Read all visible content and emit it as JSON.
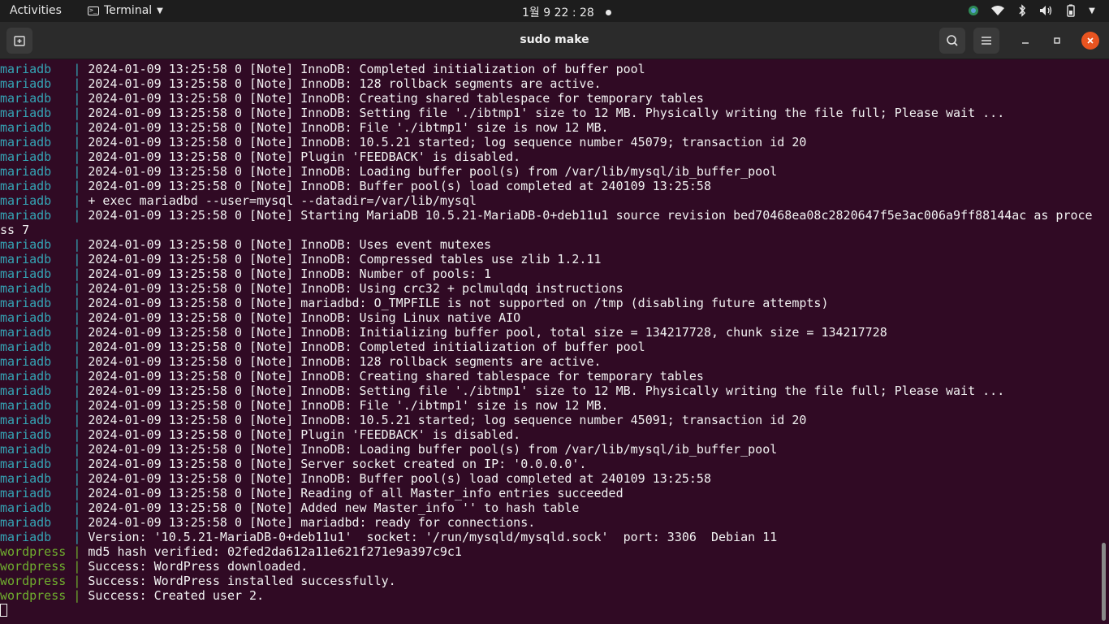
{
  "topbar": {
    "activities": "Activities",
    "app_name": "Terminal",
    "clock": "1월 9  22 : 28"
  },
  "window": {
    "title": "sudo make"
  },
  "colors": {
    "background": "#300a24",
    "mariadb": "#34a5b5",
    "wordpress": "#6fae2e",
    "close_button": "#e95420"
  },
  "terminal": {
    "lines": [
      {
        "svc": "mariadb",
        "text": "2024-01-09 13:25:58 0 [Note] InnoDB: Completed initialization of buffer pool"
      },
      {
        "svc": "mariadb",
        "text": "2024-01-09 13:25:58 0 [Note] InnoDB: 128 rollback segments are active."
      },
      {
        "svc": "mariadb",
        "text": "2024-01-09 13:25:58 0 [Note] InnoDB: Creating shared tablespace for temporary tables"
      },
      {
        "svc": "mariadb",
        "text": "2024-01-09 13:25:58 0 [Note] InnoDB: Setting file './ibtmp1' size to 12 MB. Physically writing the file full; Please wait ..."
      },
      {
        "svc": "mariadb",
        "text": "2024-01-09 13:25:58 0 [Note] InnoDB: File './ibtmp1' size is now 12 MB."
      },
      {
        "svc": "mariadb",
        "text": "2024-01-09 13:25:58 0 [Note] InnoDB: 10.5.21 started; log sequence number 45079; transaction id 20"
      },
      {
        "svc": "mariadb",
        "text": "2024-01-09 13:25:58 0 [Note] Plugin 'FEEDBACK' is disabled."
      },
      {
        "svc": "mariadb",
        "text": "2024-01-09 13:25:58 0 [Note] InnoDB: Loading buffer pool(s) from /var/lib/mysql/ib_buffer_pool"
      },
      {
        "svc": "mariadb",
        "text": "2024-01-09 13:25:58 0 [Note] InnoDB: Buffer pool(s) load completed at 240109 13:25:58"
      },
      {
        "svc": "mariadb",
        "text": "+ exec mariadbd --user=mysql --datadir=/var/lib/mysql"
      },
      {
        "svc": "mariadb",
        "text": "2024-01-09 13:25:58 0 [Note] Starting MariaDB 10.5.21-MariaDB-0+deb11u1 source revision bed70468ea08c2820647f5e3ac006a9ff88144ac as proce"
      },
      {
        "svc": "",
        "text": "ss 7"
      },
      {
        "svc": "mariadb",
        "text": "2024-01-09 13:25:58 0 [Note] InnoDB: Uses event mutexes"
      },
      {
        "svc": "mariadb",
        "text": "2024-01-09 13:25:58 0 [Note] InnoDB: Compressed tables use zlib 1.2.11"
      },
      {
        "svc": "mariadb",
        "text": "2024-01-09 13:25:58 0 [Note] InnoDB: Number of pools: 1"
      },
      {
        "svc": "mariadb",
        "text": "2024-01-09 13:25:58 0 [Note] InnoDB: Using crc32 + pclmulqdq instructions"
      },
      {
        "svc": "mariadb",
        "text": "2024-01-09 13:25:58 0 [Note] mariadbd: O_TMPFILE is not supported on /tmp (disabling future attempts)"
      },
      {
        "svc": "mariadb",
        "text": "2024-01-09 13:25:58 0 [Note] InnoDB: Using Linux native AIO"
      },
      {
        "svc": "mariadb",
        "text": "2024-01-09 13:25:58 0 [Note] InnoDB: Initializing buffer pool, total size = 134217728, chunk size = 134217728"
      },
      {
        "svc": "mariadb",
        "text": "2024-01-09 13:25:58 0 [Note] InnoDB: Completed initialization of buffer pool"
      },
      {
        "svc": "mariadb",
        "text": "2024-01-09 13:25:58 0 [Note] InnoDB: 128 rollback segments are active."
      },
      {
        "svc": "mariadb",
        "text": "2024-01-09 13:25:58 0 [Note] InnoDB: Creating shared tablespace for temporary tables"
      },
      {
        "svc": "mariadb",
        "text": "2024-01-09 13:25:58 0 [Note] InnoDB: Setting file './ibtmp1' size to 12 MB. Physically writing the file full; Please wait ..."
      },
      {
        "svc": "mariadb",
        "text": "2024-01-09 13:25:58 0 [Note] InnoDB: File './ibtmp1' size is now 12 MB."
      },
      {
        "svc": "mariadb",
        "text": "2024-01-09 13:25:58 0 [Note] InnoDB: 10.5.21 started; log sequence number 45091; transaction id 20"
      },
      {
        "svc": "mariadb",
        "text": "2024-01-09 13:25:58 0 [Note] Plugin 'FEEDBACK' is disabled."
      },
      {
        "svc": "mariadb",
        "text": "2024-01-09 13:25:58 0 [Note] InnoDB: Loading buffer pool(s) from /var/lib/mysql/ib_buffer_pool"
      },
      {
        "svc": "mariadb",
        "text": "2024-01-09 13:25:58 0 [Note] Server socket created on IP: '0.0.0.0'."
      },
      {
        "svc": "mariadb",
        "text": "2024-01-09 13:25:58 0 [Note] InnoDB: Buffer pool(s) load completed at 240109 13:25:58"
      },
      {
        "svc": "mariadb",
        "text": "2024-01-09 13:25:58 0 [Note] Reading of all Master_info entries succeeded"
      },
      {
        "svc": "mariadb",
        "text": "2024-01-09 13:25:58 0 [Note] Added new Master_info '' to hash table"
      },
      {
        "svc": "mariadb",
        "text": "2024-01-09 13:25:58 0 [Note] mariadbd: ready for connections."
      },
      {
        "svc": "mariadb",
        "text": "Version: '10.5.21-MariaDB-0+deb11u1'  socket: '/run/mysqld/mysqld.sock'  port: 3306  Debian 11"
      },
      {
        "svc": "wordpress",
        "text": "md5 hash verified: 02fed2da612a11e621f271e9a397c9c1"
      },
      {
        "svc": "wordpress",
        "text": "Success: WordPress downloaded."
      },
      {
        "svc": "wordpress",
        "text": "Success: WordPress installed successfully."
      },
      {
        "svc": "wordpress",
        "text": "Success: Created user 2."
      }
    ]
  }
}
